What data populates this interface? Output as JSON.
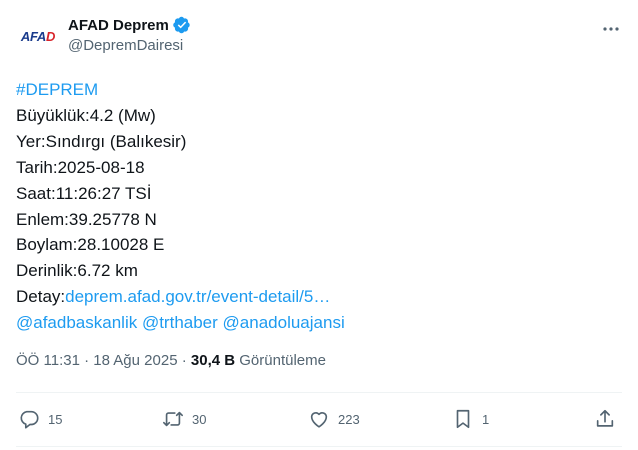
{
  "account": {
    "display_name": "AFAD Deprem",
    "handle": "@DepremDairesi",
    "avatar_logo_left": "AFA",
    "avatar_logo_right": "D",
    "verified_icon": "verified-badge-icon",
    "more_icon": "more-icon"
  },
  "post": {
    "hashtag": "#DEPREM",
    "lines": [
      "Büyüklük:4.2 (Mw)",
      "Yer:Sındırgı (Balıkesir)",
      "Tarih:2025-08-18",
      "Saat:11:26:27 TSİ",
      "Enlem:39.25778 N",
      "Boylam:28.10028 E",
      "Derinlik:6.72 km"
    ],
    "detail_label": "Detay:",
    "detail_link": "deprem.afad.gov.tr/event-detail/5…",
    "mentions": [
      "@afadbaskanlik",
      "@trthaber",
      "@anadoluajansi"
    ]
  },
  "meta": {
    "time": "ÖÖ 11:31",
    "separator": "·",
    "date": "18 Ağu 2025",
    "views_count": "30,4 B",
    "views_label": "Görüntüleme"
  },
  "actions": {
    "replies": "15",
    "reposts": "30",
    "likes": "223",
    "bookmarks": "1"
  },
  "colors": {
    "accent": "#1d9bf0",
    "text": "#0f1419",
    "secondary": "#536471",
    "divider": "#eff3f4"
  }
}
